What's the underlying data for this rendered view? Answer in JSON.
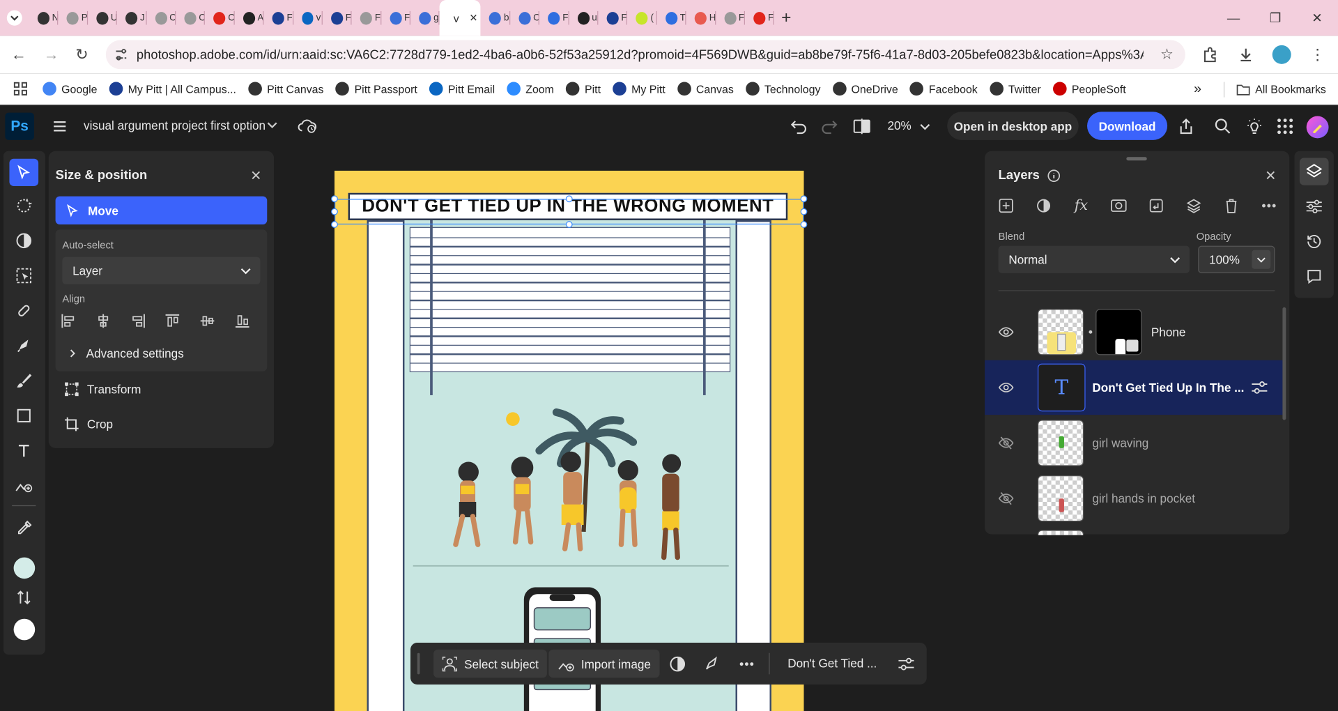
{
  "browser": {
    "tabs": [
      {
        "icon": "github-icon",
        "label": "N"
      },
      {
        "icon": "page-icon",
        "label": "P"
      },
      {
        "icon": "github-icon",
        "label": "U"
      },
      {
        "icon": "github-icon",
        "label": "J"
      },
      {
        "icon": "page-icon",
        "label": "C"
      },
      {
        "icon": "page-icon",
        "label": "C"
      },
      {
        "icon": "adobe-icon",
        "label": "C"
      },
      {
        "icon": "app-icon",
        "label": "A"
      },
      {
        "icon": "pitt-icon",
        "label": "F"
      },
      {
        "icon": "linkedin-icon",
        "label": "v"
      },
      {
        "icon": "pitt-icon",
        "label": "F"
      },
      {
        "icon": "page-icon",
        "label": "F"
      },
      {
        "icon": "s-icon",
        "label": "F"
      },
      {
        "icon": "s-icon",
        "label": "g"
      },
      {
        "icon": "s-icon",
        "label": "b"
      },
      {
        "icon": "s-icon",
        "label": "C"
      },
      {
        "icon": "form-icon",
        "label": "F"
      },
      {
        "icon": "user-icon",
        "label": "u"
      },
      {
        "icon": "pitt-icon",
        "label": "F"
      },
      {
        "icon": "h-icon",
        "label": "("
      },
      {
        "icon": "doc-icon",
        "label": "T"
      },
      {
        "icon": "c-icon",
        "label": "H"
      },
      {
        "icon": "page-icon",
        "label": "F"
      },
      {
        "icon": "adobe-icon",
        "label": "F"
      }
    ],
    "active_tab": {
      "label": "v"
    },
    "url": "photoshop.adobe.com/id/urn:aaid:sc:VA6C2:7728d779-1ed2-4ba6-a0b6-52f53a25912d?promoid=4F569DWB&guid=ab8be79f-75f6-41a7-8d03-205befe0823b&location=Apps%3APDP&...",
    "bookmarks": [
      "Google",
      "My Pitt | All Campus...",
      "Pitt Canvas",
      "Pitt Passport",
      "Pitt Email",
      "Zoom",
      "Pitt",
      "My Pitt",
      "Canvas",
      "Technology",
      "OneDrive",
      "Facebook",
      "Twitter",
      "PeopleSoft"
    ],
    "all_bookmarks": "All Bookmarks",
    "more": "»"
  },
  "app": {
    "logo": "Ps",
    "doc_title": "visual argument project first option",
    "zoom": "20%",
    "open_desktop": "Open in desktop app",
    "download": "Download"
  },
  "size_panel": {
    "title": "Size & position",
    "move": "Move",
    "auto_select_label": "Auto-select",
    "auto_select_value": "Layer",
    "align_label": "Align",
    "advanced": "Advanced settings",
    "transform": "Transform",
    "crop": "Crop"
  },
  "canvas": {
    "headline": "DON'T GET TIED UP IN THE WRONG MOMENT"
  },
  "context_bar": {
    "select_subject": "Select subject",
    "import_image": "Import image",
    "layer_name": "Don't Get Tied ..."
  },
  "layers": {
    "title": "Layers",
    "blend_label": "Blend",
    "blend_value": "Normal",
    "opacity_label": "Opacity",
    "opacity_value": "100%",
    "items": [
      {
        "name": "Phone",
        "visible": true
      },
      {
        "name": "Don't Get Tied Up In The ...",
        "visible": true
      },
      {
        "name": "girl waving",
        "visible": false
      },
      {
        "name": "girl hands in pocket",
        "visible": false
      }
    ]
  },
  "colors": {
    "accent": "#3b63fb",
    "poster_bg": "#fbd352",
    "foreground_swatch": "#d4ece8",
    "background_swatch": "#ffffff"
  }
}
